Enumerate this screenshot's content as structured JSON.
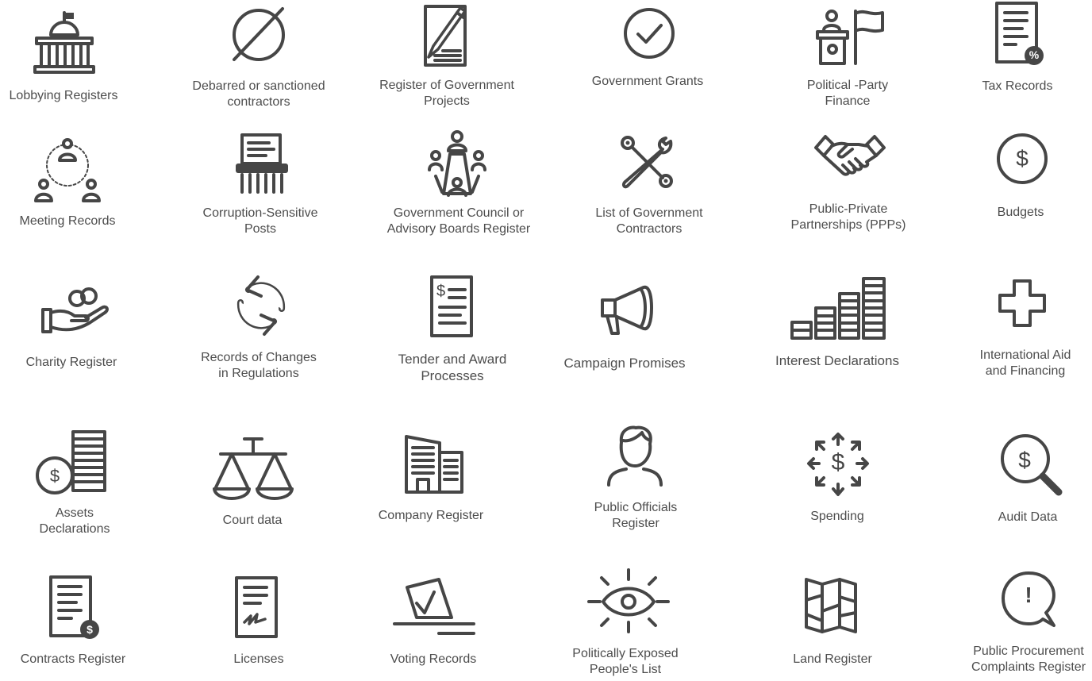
{
  "row1": {
    "lobbying": {
      "l1": "Lobbying Registers",
      "l2": ""
    },
    "debarred": {
      "l1": "Debarred or sanctioned",
      "l2": "contractors"
    },
    "projects": {
      "l1": "Register of Government",
      "l2": "Projects"
    },
    "grants": {
      "l1": "Government Grants",
      "l2": ""
    },
    "party": {
      "l1": "Political -Party",
      "l2": "Finance"
    },
    "tax": {
      "l1": "Tax Records",
      "l2": "",
      "badge": "%"
    }
  },
  "row2": {
    "meeting": {
      "l1": "Meeting Records",
      "l2": ""
    },
    "corruption": {
      "l1": "Corruption-Sensitive",
      "l2": "Posts"
    },
    "council": {
      "l1": "Government Council or",
      "l2": "Advisory Boards Register"
    },
    "contractors": {
      "l1": "List of Government",
      "l2": "Contractors"
    },
    "ppp": {
      "l1": "Public-Private",
      "l2": "Partnerships (PPPs)"
    },
    "budgets": {
      "l1": "Budgets",
      "l2": "",
      "symbol": "$"
    }
  },
  "row3": {
    "charity": {
      "l1": "Charity Register",
      "l2": ""
    },
    "regulations": {
      "l1": "Records of Changes",
      "l2": "in Regulations"
    },
    "tender": {
      "l1": "Tender and Award",
      "l2": "Processes",
      "symbol": "$"
    },
    "campaign": {
      "l1": "Campaign Promises",
      "l2": ""
    },
    "interest": {
      "l1": "Interest Declarations",
      "l2": ""
    },
    "aid": {
      "l1": "International Aid",
      "l2": "and Financing"
    }
  },
  "row4": {
    "assets": {
      "l1": "Assets",
      "l2": "Declarations",
      "symbol": "$"
    },
    "court": {
      "l1": "Court data",
      "l2": ""
    },
    "company": {
      "l1": "Company Register",
      "l2": ""
    },
    "officials": {
      "l1": "Public Officials",
      "l2": "Register"
    },
    "spending": {
      "l1": "Spending",
      "l2": "",
      "symbol": "$"
    },
    "audit": {
      "l1": "Audit Data",
      "l2": "",
      "symbol": "$"
    }
  },
  "row5": {
    "contracts": {
      "l1": "Contracts Register",
      "l2": "",
      "badge": "$"
    },
    "licenses": {
      "l1": "Licenses",
      "l2": ""
    },
    "voting": {
      "l1": "Voting Records",
      "l2": ""
    },
    "pep": {
      "l1": "Politically Exposed",
      "l2": "People's List"
    },
    "land": {
      "l1": "Land Register",
      "l2": ""
    },
    "complaints": {
      "l1": "Public Procurement",
      "l2": "Complaints Register",
      "symbol": "!"
    }
  }
}
